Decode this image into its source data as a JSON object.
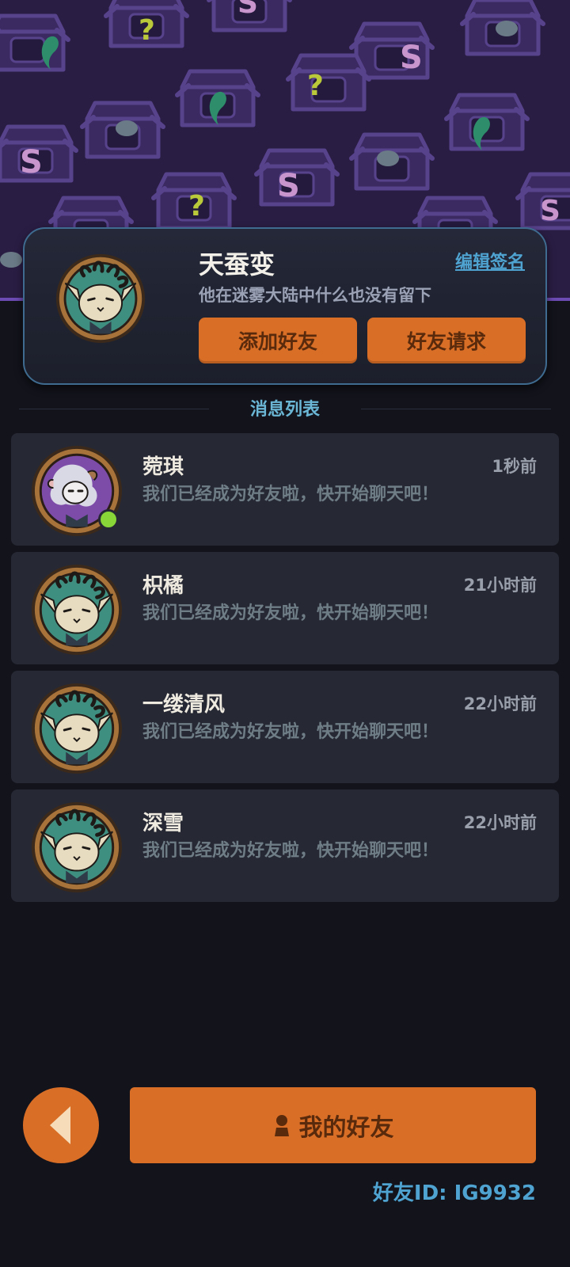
{
  "profile": {
    "name": "天蚕变",
    "signature": "他在迷雾大陆中什么也没有留下",
    "edit_label": "编辑签名",
    "add_friend_label": "添加好友",
    "friend_request_label": "好友请求"
  },
  "section_title": "消息列表",
  "messages": [
    {
      "name": "菀琪",
      "time": "1秒前",
      "text": "我们已经成为好友啦，快开始聊天吧！",
      "online": true,
      "avatar": "sheep-avatar"
    },
    {
      "name": "枳橘",
      "time": "21小时前",
      "text": "我们已经成为好友啦，快开始聊天吧！",
      "online": false,
      "avatar": "cat-avatar"
    },
    {
      "name": "一缕清风",
      "time": "22小时前",
      "text": "我们已经成为好友啦，快开始聊天吧！",
      "online": false,
      "avatar": "cat-avatar"
    },
    {
      "name": "深雪",
      "time": "22小时前",
      "text": "我们已经成为好友啦，快开始聊天吧！",
      "online": false,
      "avatar": "cat-avatar"
    }
  ],
  "footer": {
    "my_friends_label": "我的好友",
    "friend_id": "好友ID: IG9932"
  },
  "colors": {
    "accent_orange": "#d96e27",
    "link_blue": "#4fa3d1",
    "online_green": "#88d637",
    "banner_purple": "#2a1d44"
  }
}
